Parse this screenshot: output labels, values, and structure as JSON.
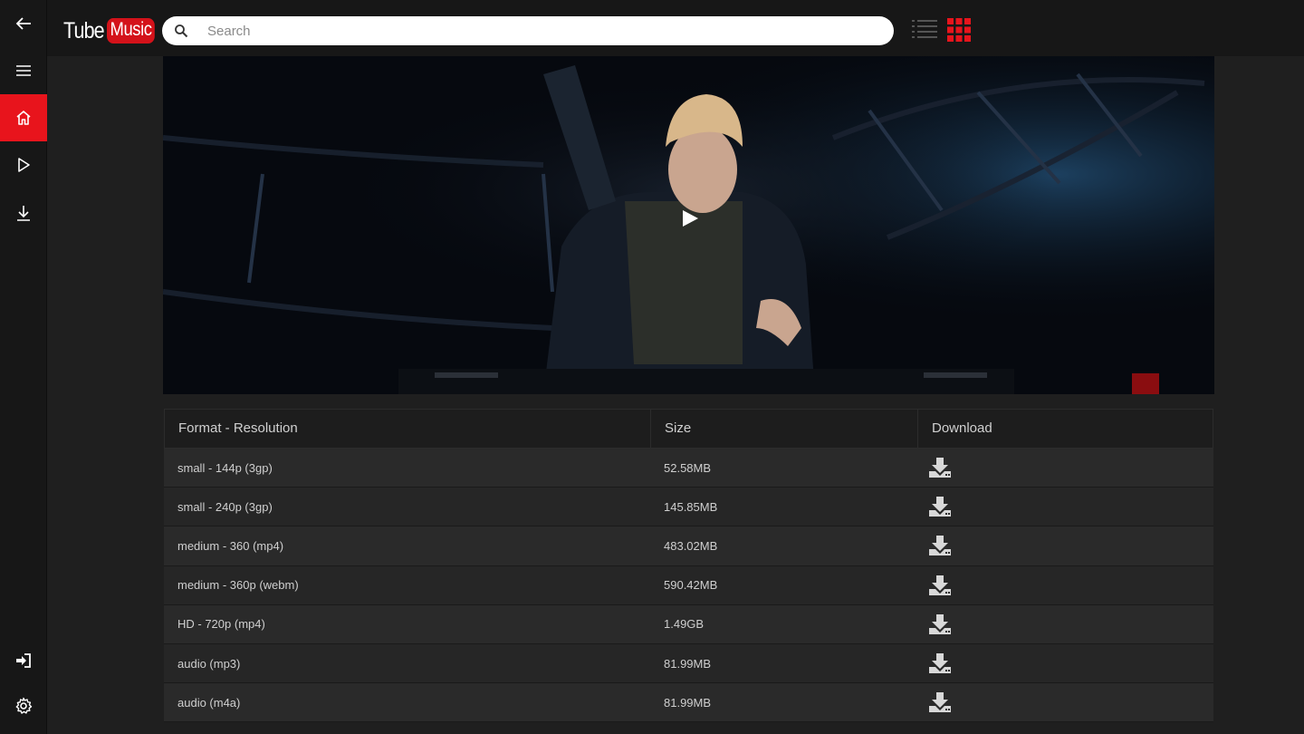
{
  "app": {
    "logo_tube": "Tube",
    "logo_music": "Music"
  },
  "search": {
    "placeholder": "Search",
    "value": ""
  },
  "sidebar": {
    "items": [
      {
        "name": "back",
        "icon": "back-arrow-icon"
      },
      {
        "name": "menu",
        "icon": "hamburger-menu-icon"
      },
      {
        "name": "home",
        "icon": "home-icon",
        "active": true
      },
      {
        "name": "play",
        "icon": "play-icon"
      },
      {
        "name": "downloads",
        "icon": "download-icon"
      },
      {
        "name": "sign-in",
        "icon": "sign-in-icon"
      },
      {
        "name": "settings",
        "icon": "gear-icon"
      }
    ]
  },
  "view_toggle": {
    "list_icon": "list-view-icon",
    "grid_icon": "grid-view-icon",
    "active": "grid"
  },
  "colors": {
    "accent": "#e8141c",
    "background": "#1f1f1f",
    "sidebar": "#171717"
  },
  "table": {
    "headers": [
      "Format - Resolution",
      "Size",
      "Download"
    ],
    "rows": [
      {
        "format": "small - 144p (3gp)",
        "size": "52.58MB"
      },
      {
        "format": "small - 240p (3gp)",
        "size": "145.85MB"
      },
      {
        "format": "medium - 360 (mp4)",
        "size": "483.02MB"
      },
      {
        "format": "medium - 360p (webm)",
        "size": "590.42MB"
      },
      {
        "format": "HD - 720p (mp4)",
        "size": "1.49GB"
      },
      {
        "format": "audio (mp3)",
        "size": "81.99MB"
      },
      {
        "format": "audio (m4a)",
        "size": "81.99MB"
      }
    ]
  }
}
